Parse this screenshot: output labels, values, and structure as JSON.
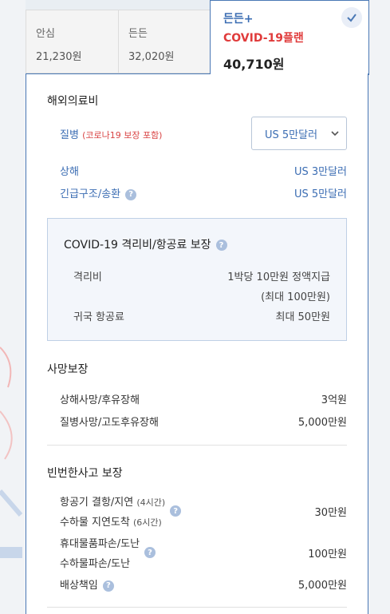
{
  "tabs": [
    {
      "name": "안심",
      "price": "21,230원"
    },
    {
      "name": "든든",
      "price": "32,020원"
    },
    {
      "name": "든든+",
      "sub": "COVID-19플랜",
      "price": "40,710원"
    }
  ],
  "overseas": {
    "title": "해외의료비",
    "disease_label": "질병",
    "disease_note": "(코로나19 보장 포함)",
    "disease_value": "US 5만달러",
    "injury_label": "상해",
    "injury_value": "US 3만달러",
    "rescue_label": "긴급구조/송환",
    "rescue_value": "US 5만달러"
  },
  "covid_box": {
    "title": "COVID-19 격리비/항공료 보장",
    "rows": [
      {
        "label": "격리비",
        "value_line1": "1박당 10만원 정액지급",
        "value_line2": "(최대 100만원)"
      },
      {
        "label": "귀국 항공료",
        "value_line1": "최대 50만원"
      }
    ]
  },
  "death": {
    "title": "사망보장",
    "rows": [
      {
        "label": "상해사망/후유장해",
        "value": "3억원"
      },
      {
        "label": "질병사망/고도후유장해",
        "value": "5,000만원"
      }
    ]
  },
  "frequent": {
    "title": "빈번한사고 보장",
    "flight_l1": "항공기 결항/지연",
    "flight_l1_note": "(4시간)",
    "flight_l2": "수하물 지연도착",
    "flight_l2_note": "(6시간)",
    "flight_value": "30만원",
    "goods_l1": "휴대물품파손/도난",
    "goods_l2": "수하물파손/도난",
    "goods_value": "100만원",
    "liability_label": "배상책임",
    "liability_value": "5,000만원"
  },
  "icons": {
    "help": "?"
  }
}
